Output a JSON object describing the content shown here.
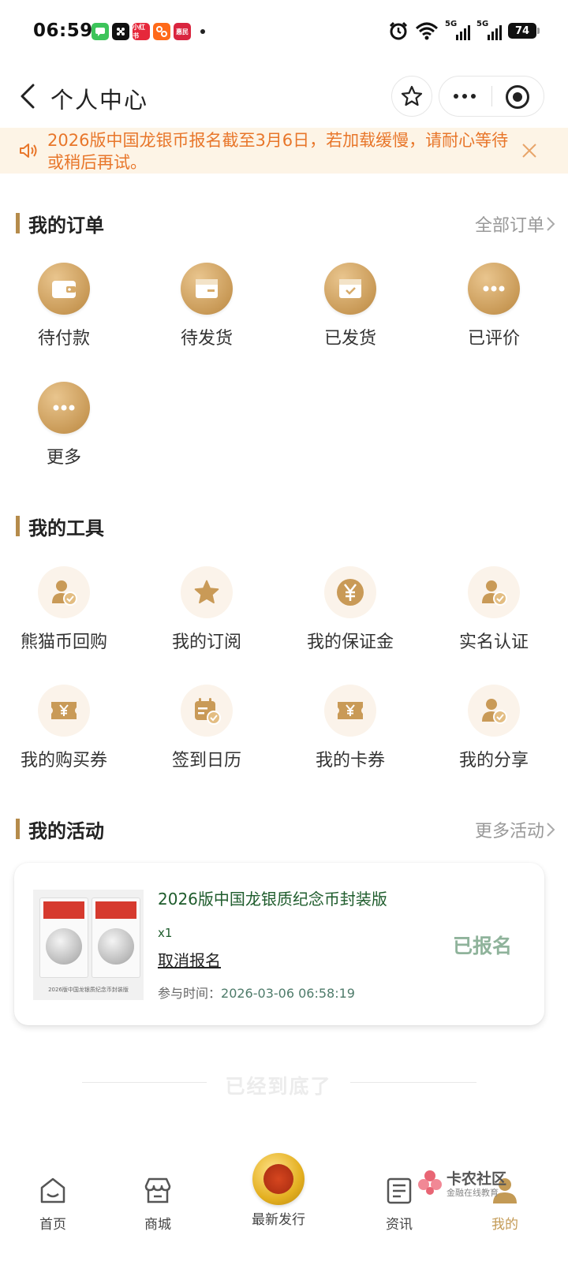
{
  "status_bar": {
    "time": "06:59",
    "notification_icons": [
      {
        "name": "messages-app-icon",
        "color": "#3cc45a",
        "text": ""
      },
      {
        "name": "dice-app-icon",
        "color": "#111111",
        "text": ""
      },
      {
        "name": "xiaohongshu-app-icon",
        "color": "#e6283b",
        "text": "小红书"
      },
      {
        "name": "taobao-app-icon",
        "color": "#ff6a1a",
        "text": ""
      },
      {
        "name": "app-icon",
        "color": "#d9253f",
        "text": "惠民"
      }
    ],
    "signal_1": "5G",
    "signal_2": "5G",
    "battery": "74"
  },
  "nav": {
    "title": "个人中心"
  },
  "notice": {
    "text": "2026版中国龙银币报名截至3月6日，若加载缓慢，请耐心等待或稍后再试。",
    "color": "#e8762a"
  },
  "orders": {
    "title": "我的订单",
    "more": "全部订单",
    "items": [
      {
        "label": "待付款",
        "icon": "wallet-icon"
      },
      {
        "label": "待发货",
        "icon": "package-icon"
      },
      {
        "label": "已发货",
        "icon": "shipped-box-icon"
      },
      {
        "label": "已评价",
        "icon": "comment-dots-icon"
      },
      {
        "label": "更多",
        "icon": "more-dots-icon"
      }
    ]
  },
  "tools": {
    "title": "我的工具",
    "items": [
      {
        "label": "熊猫币回购",
        "icon": "user-check-icon"
      },
      {
        "label": "我的订阅",
        "icon": "star-icon"
      },
      {
        "label": "我的保证金",
        "icon": "yen-coin-icon"
      },
      {
        "label": "实名认证",
        "icon": "user-check-icon"
      },
      {
        "label": "我的购买券",
        "icon": "ticket-icon"
      },
      {
        "label": "签到日历",
        "icon": "calendar-check-icon"
      },
      {
        "label": "我的卡券",
        "icon": "ticket-icon"
      },
      {
        "label": "我的分享",
        "icon": "user-check-icon"
      }
    ]
  },
  "activities": {
    "title": "我的活动",
    "more": "更多活动",
    "card": {
      "title": "2026版中国龙银质纪念币封装版",
      "quantity": "x1",
      "cancel": "取消报名",
      "time_label": "参与时间：",
      "time_value": "2026-03-06 06:58:19",
      "status": "已报名",
      "image_caption": "2026版中国龙银质纪念币封装版"
    }
  },
  "end_text": "已经到底了",
  "tabs": [
    {
      "label": "首页",
      "icon": "home-icon",
      "active": false
    },
    {
      "label": "商城",
      "icon": "store-icon",
      "active": false
    },
    {
      "label": "最新发行",
      "icon": "medal-icon",
      "active": false
    },
    {
      "label": "资讯",
      "icon": "news-icon",
      "active": false
    },
    {
      "label": "我的",
      "icon": "user-icon",
      "active": true
    }
  ],
  "watermark": {
    "title": "卡农社区",
    "subtitle": "金融在线教育"
  },
  "colors": {
    "accent_gold": "#c39a55",
    "activity_green": "#1e5c2c",
    "status_green": "#8fb39b"
  }
}
